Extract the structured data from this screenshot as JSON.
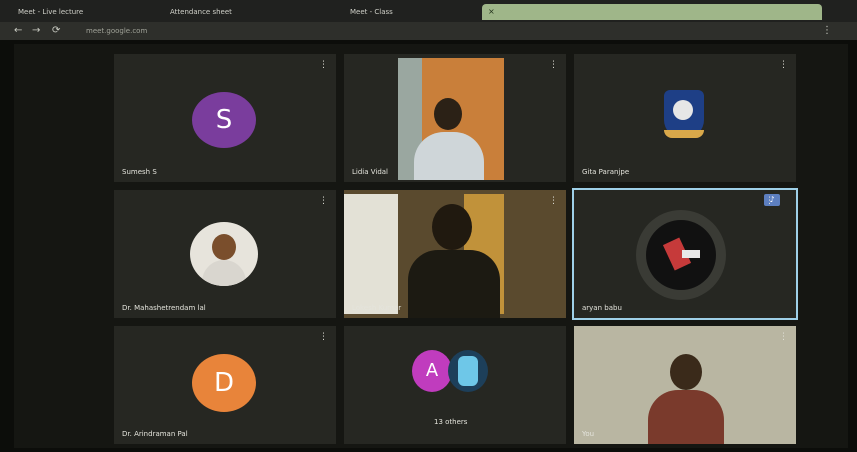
{
  "browser": {
    "tabs": [
      {
        "label": "Meet - Live lecture"
      },
      {
        "label": "Attendance sheet"
      },
      {
        "label": "Meet - Class"
      }
    ],
    "url": "meet.google.com"
  },
  "tiles": [
    {
      "name": "Sumesh S",
      "initial": "S",
      "avatar_color": "#7a3d9d"
    },
    {
      "name": "Lidia Vidal",
      "type": "camera"
    },
    {
      "name": "Gita Paranjpe",
      "type": "logo"
    },
    {
      "name": "Dr. Mahashetrendam lal",
      "type": "photo"
    },
    {
      "name": "Lokesh Kumar",
      "type": "camera"
    },
    {
      "name": "aryan babu",
      "type": "photo",
      "speaking": true
    },
    {
      "name": "Dr. Arindraman Pal",
      "initial": "D",
      "avatar_color": "#e8843a"
    },
    {
      "name": "13 others",
      "type": "group",
      "initial": "A"
    },
    {
      "name": "You",
      "type": "camera"
    }
  ],
  "icons": {
    "more": "more-vertical-icon",
    "back": "back-arrow-icon",
    "forward": "forward-arrow-icon",
    "reload": "reload-icon"
  }
}
